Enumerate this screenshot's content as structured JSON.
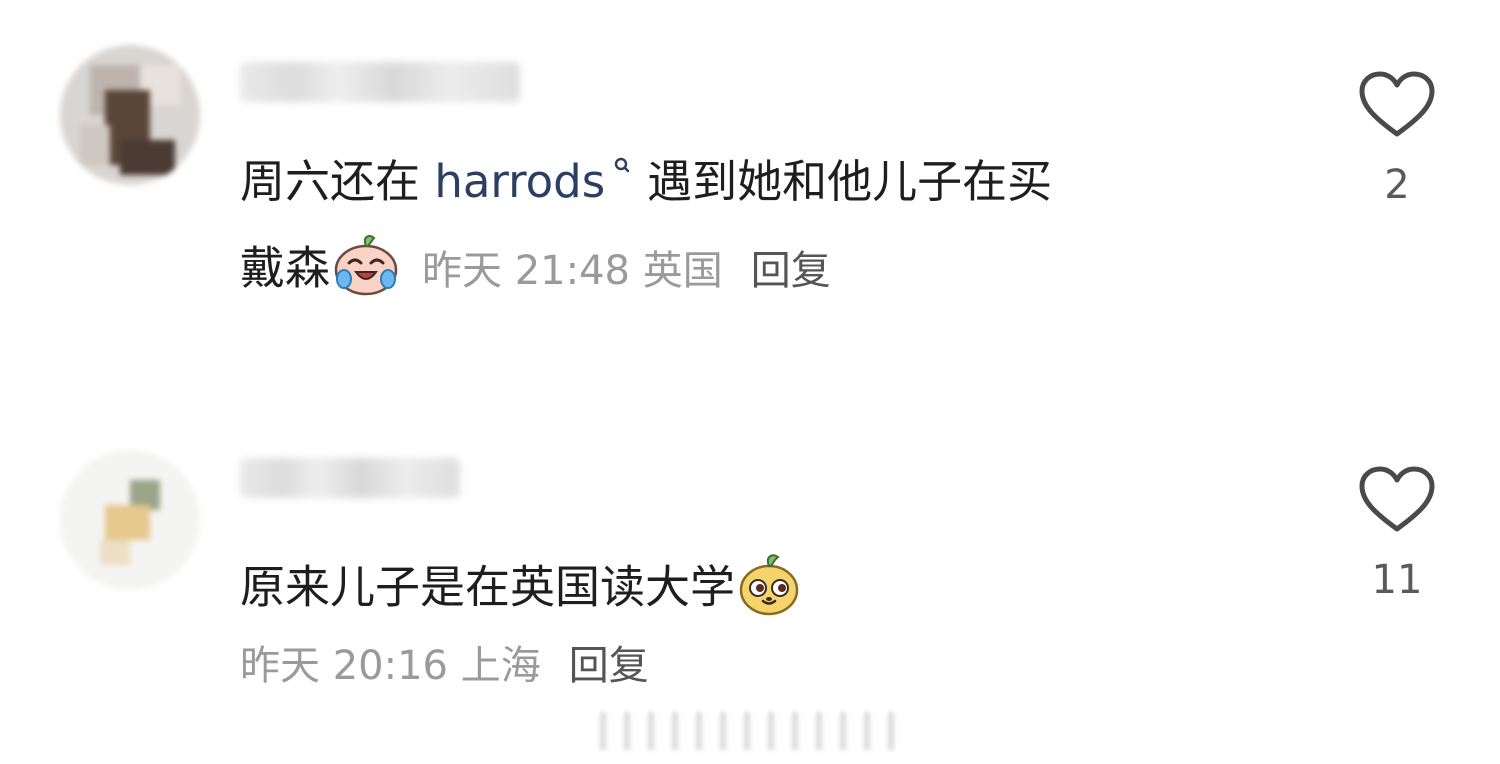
{
  "comments": [
    {
      "text_before": "周六还在 ",
      "link": "harrods",
      "text_after": "遇到她和他儿子在买",
      "text_line2": "戴森",
      "emoji": "laughing-crying-face-icon",
      "time": "昨天 21:48 英国",
      "reply": "回复",
      "likes": "2"
    },
    {
      "text": "原来儿子是在英国读大学",
      "emoji": "smug-face-icon",
      "time": "昨天 20:16 上海",
      "reply": "回复",
      "likes": "11"
    }
  ],
  "colors": {
    "link": "#2b3f63",
    "meta": "#9a9a9a",
    "text": "#1e1e1e"
  }
}
